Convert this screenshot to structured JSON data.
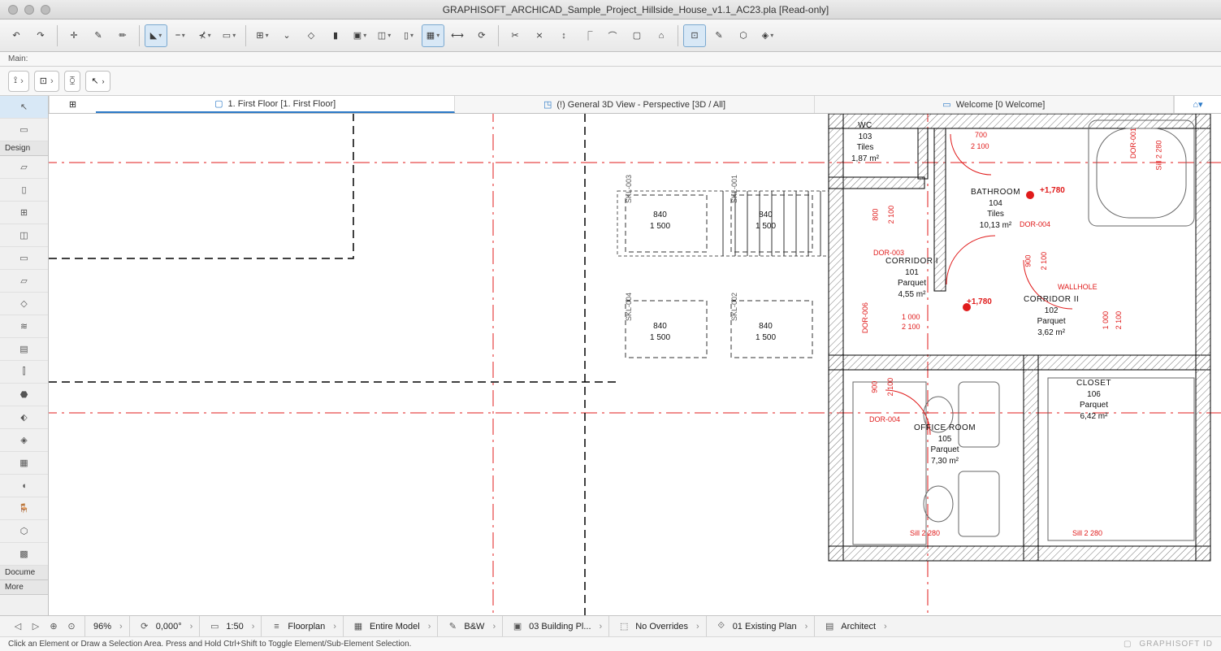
{
  "window": {
    "title": "GRAPHISOFT_ARCHICAD_Sample_Project_Hillside_House_v1.1_AC23.pla [Read-only]"
  },
  "mainlabel": "Main:",
  "tabs": [
    {
      "label": "1. First Floor [1. First Floor]"
    },
    {
      "label": "(!) General 3D View - Perspective [3D / All]"
    },
    {
      "label": "Welcome [0 Welcome]"
    }
  ],
  "palette": {
    "design_header": "Design",
    "docume_header": "Docume",
    "more_header": "More"
  },
  "rooms": {
    "wc": {
      "name": "WC",
      "num": "103",
      "finish": "Tiles",
      "area": "1,87 m²"
    },
    "bath": {
      "name": "BATHROOM",
      "num": "104",
      "finish": "Tiles",
      "area": "10,13 m²"
    },
    "corr1": {
      "name": "CORRIDOR I",
      "num": "101",
      "finish": "Parquet",
      "area": "4,55 m²"
    },
    "corr2": {
      "name": "CORRIDOR II",
      "num": "102",
      "finish": "Parquet",
      "area": "3,62 m²"
    },
    "closet": {
      "name": "CLOSET",
      "num": "106",
      "finish": "Parquet",
      "area": "6,42 m²"
    },
    "office": {
      "name": "OFFICE ROOM",
      "num": "105",
      "finish": "Parquet",
      "area": "7,30 m²"
    }
  },
  "skylights": {
    "s1": {
      "id": "SKL-003",
      "w": "840",
      "h": "1 500"
    },
    "s2": {
      "id": "SKL-001",
      "w": "840",
      "h": "1 500"
    },
    "s3": {
      "id": "SKL-004",
      "w": "840",
      "h": "1 500"
    },
    "s4": {
      "id": "SKL-002",
      "w": "840",
      "h": "1 500"
    }
  },
  "doors": {
    "d1": "DOR-001",
    "d3": "DOR-003",
    "d4": "DOR-004",
    "d4b": "DOR-004",
    "d6": "DOR-006"
  },
  "dims": {
    "d800": "800",
    "d900": "900",
    "d700": "700",
    "d1000": "1 000",
    "d2100": "2 100",
    "d2280": "2 280",
    "sill": "Sill 2 280",
    "sill2": "Sill 2 280",
    "wallhole": "WALLHOLE"
  },
  "elev": {
    "e1": "+1,780",
    "e2": "+1,780"
  },
  "viewbar": {
    "zoom": "96%",
    "angle": "0,000°",
    "scale": "1:50",
    "view": "Floorplan",
    "model": "Entire Model",
    "pen": "B&W",
    "plan": "03 Building Pl...",
    "override": "No Overrides",
    "reno": "01 Existing Plan",
    "role": "Architect"
  },
  "status": {
    "hint": "Click an Element or Draw a Selection Area. Press and Hold Ctrl+Shift to Toggle Element/Sub-Element Selection.",
    "brand": "GRAPHISOFT ID"
  }
}
